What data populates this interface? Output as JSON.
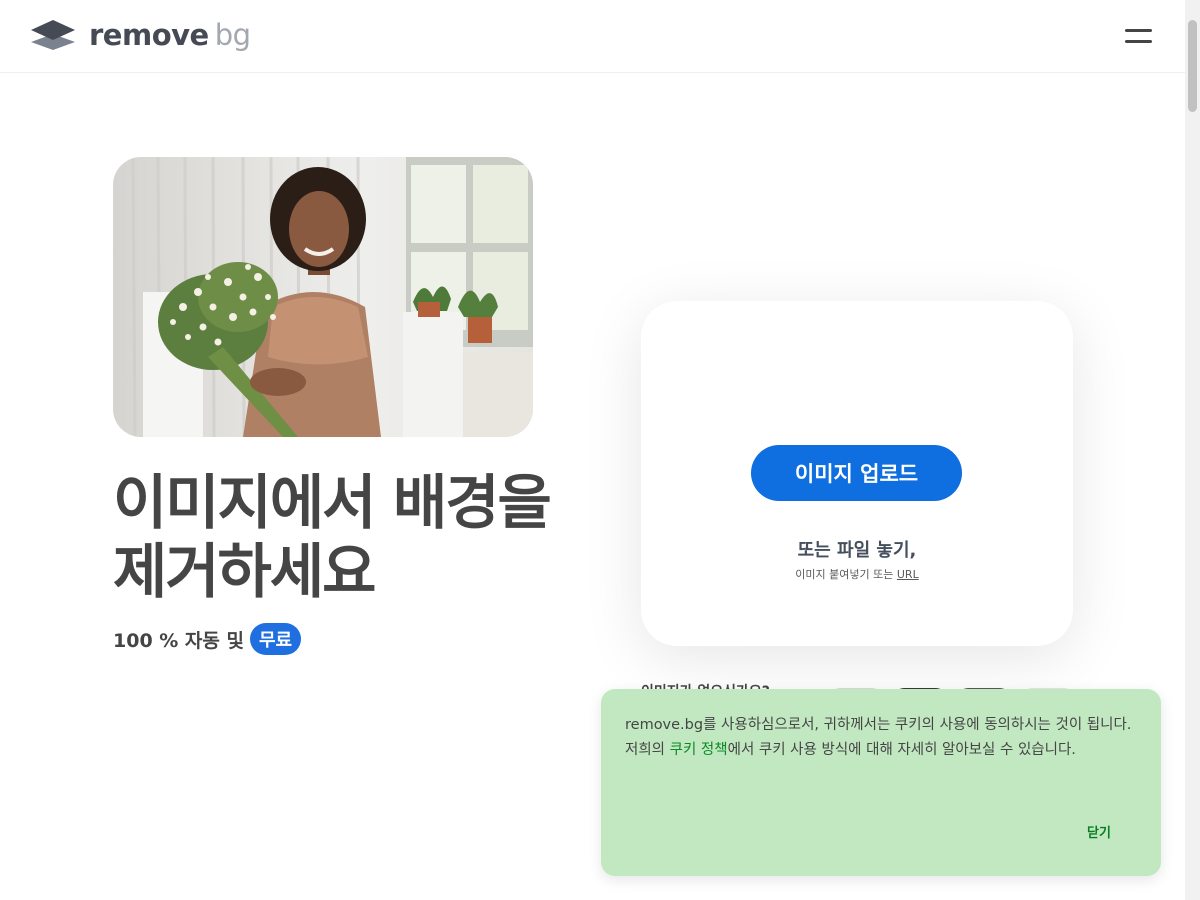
{
  "header": {
    "logo_word_1": "remove",
    "logo_word_2": "bg",
    "menu_icon": "hamburger-menu-icon"
  },
  "hero": {
    "image_alt": "woman-holding-flower-bouquet-photo",
    "headline": "이미지에서 배경을 제거하세요",
    "subline_prefix": "100 % 자동 및",
    "free_badge": "무료"
  },
  "upload": {
    "button_label": "이미지 업로드",
    "drop_text": "또는 파일 놓기,",
    "paste_prefix": "이미지 붙여넣기 또는",
    "url_link": "URL"
  },
  "samples": {
    "heading": "이미지가 없으신가요?"
  },
  "cookie": {
    "text_before": "remove.bg를 사용하심으로서, 귀하께서는 쿠키의 사용에 동의하시는 것이 됩니다. 저희의 ",
    "link": "쿠키 정책",
    "text_after": "에서 쿠키 사용 방식에 대해 자세히 알아보실 수 있습니다.",
    "close_label": "닫기"
  },
  "colors": {
    "accent_blue": "#0f6ee0",
    "cookie_bg": "#c2e8c2",
    "cookie_link": "#0a8a26",
    "text_dark": "#454545"
  }
}
